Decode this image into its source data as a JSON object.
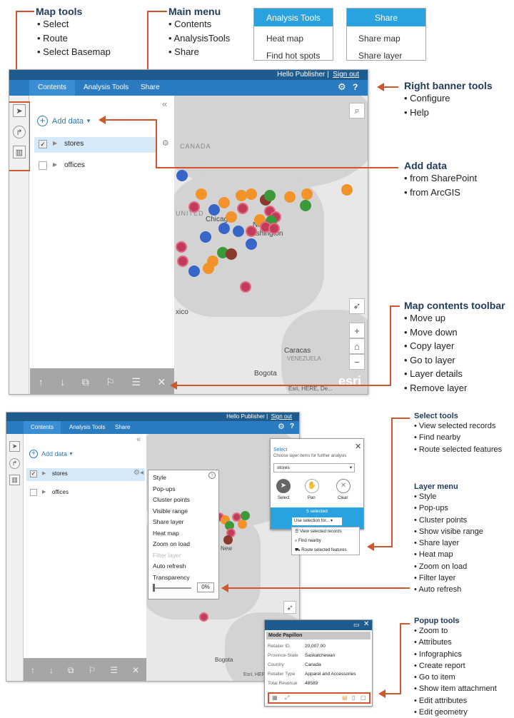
{
  "annotations": {
    "map_tools": {
      "title": "Map tools",
      "items": [
        "Select",
        "Route",
        "Select Basemap"
      ]
    },
    "main_menu": {
      "title": "Main menu",
      "items": [
        "Contents",
        "AnalysisTools",
        "Share"
      ]
    },
    "right_banner": {
      "title": "Right banner tools",
      "items": [
        "Configure",
        "Help"
      ]
    },
    "add_data": {
      "title": "Add data",
      "items": [
        "from SharePoint",
        "from ArcGIS"
      ]
    },
    "map_contents_toolbar": {
      "title": "Map contents toolbar",
      "items": [
        "Move up",
        "Move down",
        "Copy layer",
        "Go to layer",
        "Layer details",
        "Remove layer"
      ]
    },
    "select_tools": {
      "title": "Select tools",
      "items": [
        "View selected records",
        "Find nearby",
        "Route selected features"
      ]
    },
    "layer_menu": {
      "title": "Layer menu",
      "items": [
        "Style",
        "Pop-ups",
        "Cluster points",
        "Show visibe range",
        "Share layer",
        "Heat map",
        "Zoom on load",
        "Filter layer",
        "Auto refresh"
      ]
    },
    "popup_tools": {
      "title": "Popup tools",
      "items": [
        "Zoom to",
        "Attributes",
        "Infographics",
        "Create report",
        "Go to item",
        "Show item attachment",
        "Edit attributes",
        "Edit geometry"
      ]
    }
  },
  "analysis_menu": {
    "header": "Analysis Tools",
    "items": [
      "Heat map",
      "Find hot spots"
    ]
  },
  "share_menu": {
    "header": "Share",
    "items": [
      "Share map",
      "Share layer"
    ]
  },
  "app": {
    "user": "Hello Publisher",
    "sign_out": "Sign out",
    "tabs": [
      "Contents",
      "Analysis Tools",
      "Share"
    ],
    "add_data": "Add data",
    "layers": [
      "stores",
      "offices"
    ],
    "map_labels": {
      "canada": "CANADA",
      "united": "UNITED",
      "chicago": "Chicago",
      "new": "New",
      "washington": "Washington",
      "mexico": "xico",
      "caracas": "Caracas",
      "venezuela": "VENEZUELA",
      "bogota": "Bogota",
      "attribution": "Esri, HERE, De...",
      "esri": "esri"
    }
  },
  "layer_menu_popup": {
    "items": [
      "Style",
      "Pop-ups",
      "Cluster points",
      "Visible range",
      "Share layer",
      "Heat map",
      "Zoom on load",
      "Filter layer",
      "Auto refresh",
      "Transparency"
    ],
    "disabled": [
      "Filter layer"
    ],
    "transparency": "0%"
  },
  "select_panel": {
    "title": "Select",
    "subtitle": "Choose layer items for further analysis",
    "layer": "stores",
    "buttons": [
      "Select",
      "Pan",
      "Clear"
    ],
    "selected": "5 selected",
    "use_selection": "Use selection for...",
    "options": [
      "View selected records",
      "Find nearby",
      "Route selected features"
    ]
  },
  "popup": {
    "title": "Mode Papillon",
    "rows": [
      [
        "Retailer ID",
        "20,007.00"
      ],
      [
        "Province-State",
        "Saskatchewan"
      ],
      [
        "Country",
        "Canada"
      ],
      [
        "Retailer Type",
        "Apparel and Accessories"
      ],
      [
        "Total Revenue",
        "48589"
      ]
    ]
  },
  "colors": {
    "accent": "#d2562d",
    "nav": "#2a7bbf",
    "topbar": "#1e5b8e",
    "menu_header": "#29a3e0"
  }
}
